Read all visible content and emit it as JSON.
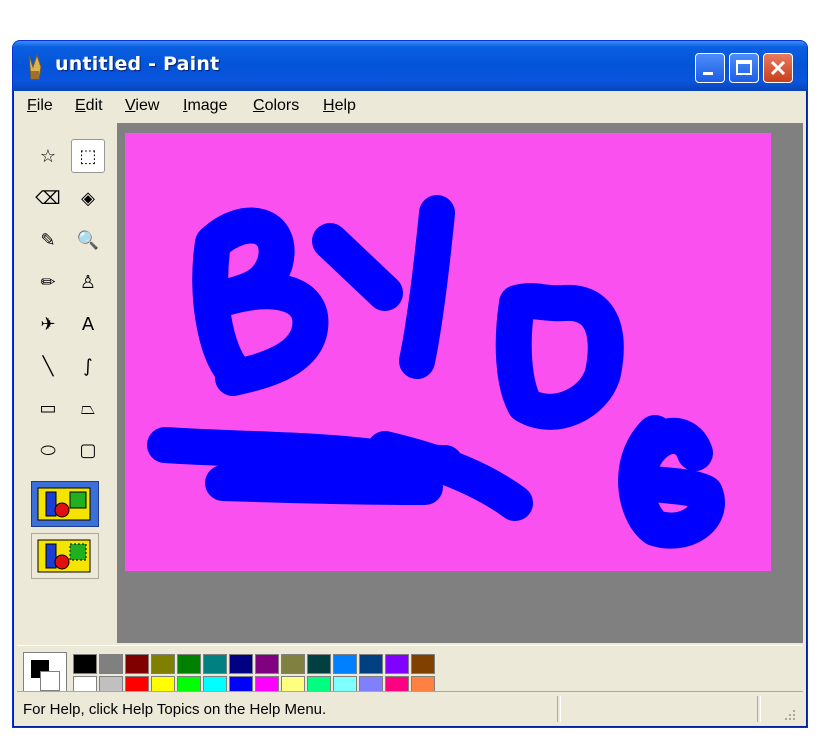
{
  "window": {
    "title": "untitled - Paint"
  },
  "menu": [
    {
      "label": "File",
      "u": "F",
      "rest": "ile"
    },
    {
      "label": "Edit",
      "u": "E",
      "rest": "dit"
    },
    {
      "label": "View",
      "u": "V",
      "rest": "iew"
    },
    {
      "label": "Image",
      "u": "I",
      "rest": "mage"
    },
    {
      "label": "Colors",
      "u": "C",
      "rest": "olors"
    },
    {
      "label": "Help",
      "u": "H",
      "rest": "elp"
    }
  ],
  "tools": [
    {
      "name": "free-form-select-icon",
      "glyph": "☆"
    },
    {
      "name": "select-icon",
      "glyph": "⬚",
      "selected": true
    },
    {
      "name": "eraser-icon",
      "glyph": "⌫"
    },
    {
      "name": "fill-with-color-icon",
      "glyph": "◈"
    },
    {
      "name": "pick-color-icon",
      "glyph": "✎"
    },
    {
      "name": "magnifier-icon",
      "glyph": "🔍"
    },
    {
      "name": "pencil-icon",
      "glyph": "✏"
    },
    {
      "name": "brush-icon",
      "glyph": "♙"
    },
    {
      "name": "airbrush-icon",
      "glyph": "✈"
    },
    {
      "name": "text-icon",
      "glyph": "A"
    },
    {
      "name": "line-icon",
      "glyph": "╲"
    },
    {
      "name": "curve-icon",
      "glyph": "∫"
    },
    {
      "name": "rectangle-icon",
      "glyph": "▭"
    },
    {
      "name": "polygon-icon",
      "glyph": "⏢"
    },
    {
      "name": "ellipse-icon",
      "glyph": "⬭"
    },
    {
      "name": "rounded-rectangle-icon",
      "glyph": "▢"
    }
  ],
  "colors": {
    "canvas": "#fa50f0",
    "stroke": "#0000ff",
    "foreground": "#000000",
    "background": "#ffffff"
  },
  "palette": [
    "#000000",
    "#808080",
    "#800000",
    "#808000",
    "#008000",
    "#008080",
    "#000080",
    "#800080",
    "#808040",
    "#004040",
    "#0080ff",
    "#004080",
    "#8000ff",
    "#804000",
    "#ffffff",
    "#c0c0c0",
    "#ff0000",
    "#ffff00",
    "#00ff00",
    "#00ffff",
    "#0000ff",
    "#ff00ff",
    "#ffff80",
    "#00ff80",
    "#80ffff",
    "#8080ff",
    "#ff0080",
    "#ff8040"
  ],
  "status": {
    "text": "For Help, click Help Topics on the Help Menu."
  }
}
